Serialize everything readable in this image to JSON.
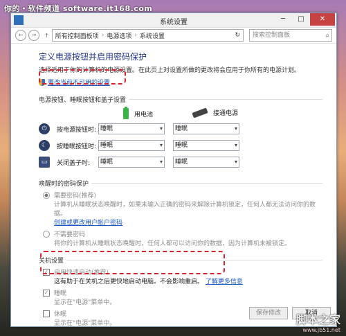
{
  "watermark_top": "你的・软件频道 software.it168.com",
  "window": {
    "title": "系统设置",
    "min": "─",
    "max": "□",
    "close": "✕"
  },
  "nav": {
    "back": "←",
    "forward": "→",
    "up": "↑",
    "crumbs": [
      "所有控制面板项",
      "电源选项",
      "系统设置"
    ],
    "search_placeholder": "搜索控制面板",
    "refresh": "↻"
  },
  "header": {
    "title": "定义电源按钮并启用密码保护",
    "description": "选择适用于你的计算机的电源设置。在此页上对设置所做的更改将会应用于你所有的电源计划。",
    "change_link": "更改当前不可用的设置"
  },
  "power_section": {
    "label": "电源按钮、睡眠按钮和盖子设置",
    "col_battery": "用电池",
    "col_plugged": "接通电源",
    "rows": [
      {
        "label": "按电源按钮时:",
        "battery": "睡眠",
        "plugged": "睡眠"
      },
      {
        "label": "按睡眠按钮时:",
        "battery": "睡眠",
        "plugged": "睡眠"
      },
      {
        "label": "关闭盖子时:",
        "battery": "睡眠",
        "plugged": "睡眠"
      }
    ]
  },
  "password_section": {
    "label": "唤醒时的密码保护",
    "require_title": "需要密码(推荐)",
    "require_desc": "计算机从睡眠状态唤醒时，如果未输入正确的密码来解除计算机锁定，任何人都无法访问你的数据。",
    "require_link": "创建或更改用户帐户密码",
    "norequire_title": "不需要密码",
    "norequire_desc": "将你的计算机从睡眠状态唤醒时，任何人都可以访问你的数据，因为计算机未被锁定。"
  },
  "shutdown_section": {
    "label": "关机设置",
    "fast_title": "启用快速启动(推荐)",
    "fast_desc": "这有助于在关机之后更快地启动电脑。不会影响重启。",
    "fast_link": "了解更多信息",
    "sleep_title": "睡眠",
    "sleep_desc": "显示在\"电源\"菜单中。",
    "hibernate_title": "休眠",
    "hibernate_desc": "显示在\"电源\"菜单中。"
  },
  "buttons": {
    "save": "保存修改",
    "cancel": "取消"
  },
  "watermark_br": {
    "big": "脚本之家",
    "small": "www.jb51.net"
  }
}
